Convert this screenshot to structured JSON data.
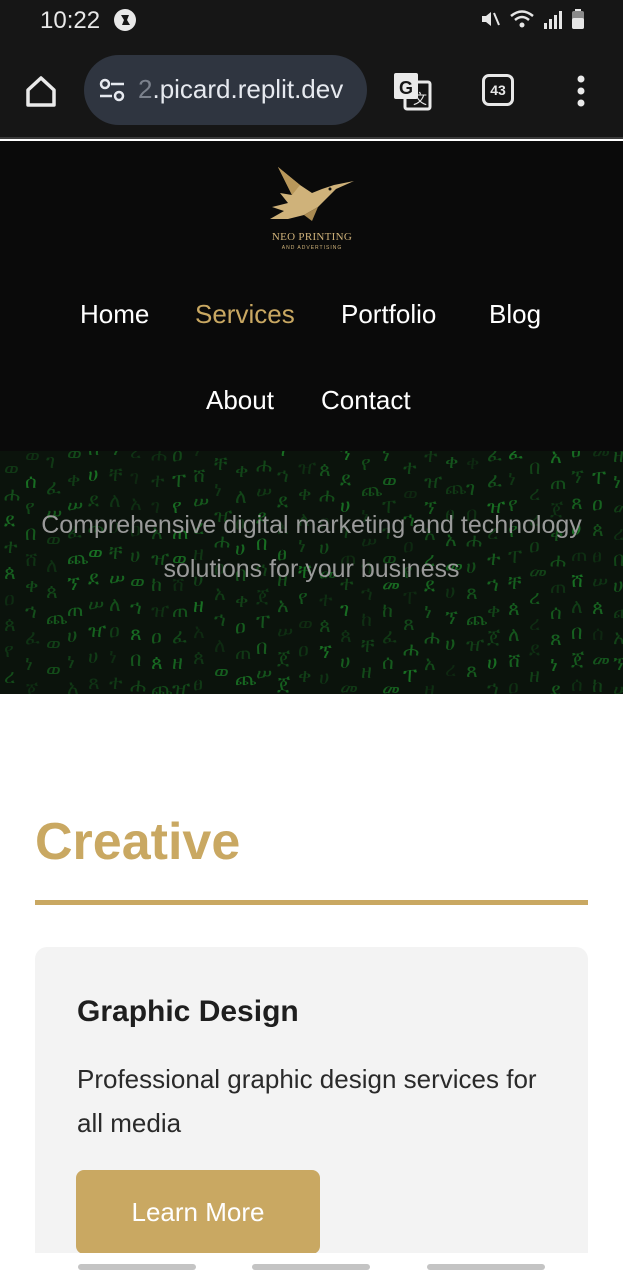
{
  "status_bar": {
    "time": "10:22",
    "icons": [
      "app-notification-icon",
      "mute-icon",
      "wifi-icon",
      "signal-icon",
      "battery-icon"
    ]
  },
  "browser": {
    "url_faded": "2",
    "url": ".picard.replit.dev",
    "tab_count": "43",
    "icons": [
      "home-icon",
      "site-settings-icon",
      "translate-icon",
      "tabs-icon",
      "more-vert-icon"
    ]
  },
  "site": {
    "logo_title": "NEO PRINTING",
    "logo_subtitle": "AND ADVERTISING",
    "nav": [
      {
        "label": "Home"
      },
      {
        "label": "Services"
      },
      {
        "label": "Portfolio"
      },
      {
        "label": "Blog"
      },
      {
        "label": "About"
      },
      {
        "label": "Contact"
      }
    ],
    "active_nav": "Services",
    "hero_text": "Comprehensive digital marketing and technology solutions for your business"
  },
  "section": {
    "title": "Creative",
    "card": {
      "title": "Graphic Design",
      "description": "Professional graphic design services for all media",
      "button": "Learn More"
    }
  },
  "colors": {
    "accent_gold": "#c9a862",
    "header_bg": "#0a0a0a",
    "browser_bg": "#161616",
    "card_bg": "#f3f3f3",
    "matrix_green": "#1f9a2e"
  }
}
